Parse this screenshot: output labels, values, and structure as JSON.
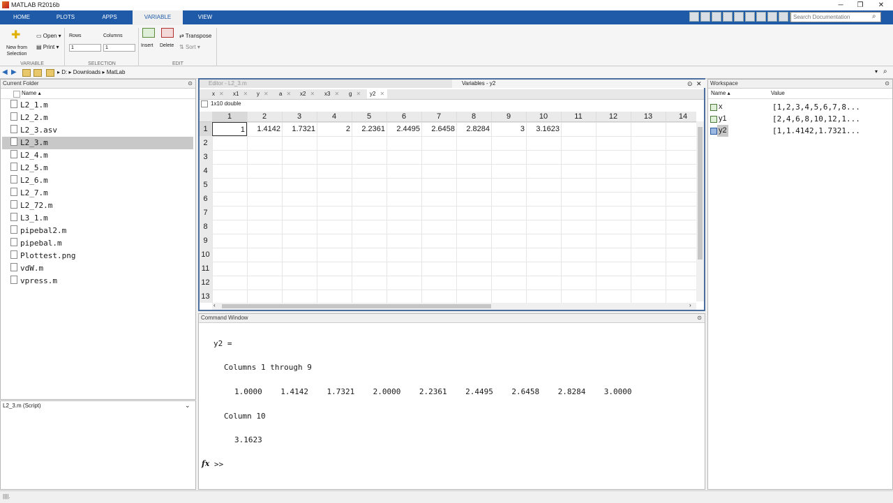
{
  "window": {
    "title": "MATLAB R2016b",
    "controls": [
      "─",
      "❐",
      "✕"
    ]
  },
  "ribbon_tabs": [
    "HOME",
    "PLOTS",
    "APPS",
    "VARIABLE",
    "VIEW"
  ],
  "search": {
    "placeholder": "Search Documentation"
  },
  "ribbon": {
    "new_from_selection": "New from Selection",
    "open": "Open",
    "print": "Print",
    "rows_label": "Rows",
    "columns_label": "Columns",
    "rows_value": "1",
    "columns_value": "1",
    "insert": "Insert",
    "delete": "Delete",
    "transpose": "Transpose",
    "sort": "Sort",
    "groups": [
      "VARIABLE",
      "SELECTION",
      "EDIT"
    ]
  },
  "address": {
    "path": [
      "D:",
      "Downloads",
      "MatLab"
    ]
  },
  "current_folder": {
    "title": "Current Folder",
    "col_name": "Name",
    "files": [
      "L2_1.m",
      "L2_2.m",
      "L2_3.asv",
      "L2_3.m",
      "L2_4.m",
      "L2_5.m",
      "L2_6.m",
      "L2_7.m",
      "L2_72.m",
      "L3_1.m",
      "pipebal2.m",
      "pipebal.m",
      "Plottest.png",
      "vdW.m",
      "vpress.m"
    ],
    "selected_index": 3,
    "details": "L2_3.m (Script)"
  },
  "editor": {
    "title": "Editor - L2_3.m"
  },
  "variables": {
    "title": "Variables - y2",
    "tabs": [
      "x",
      "x1",
      "y",
      "a",
      "x2",
      "x3",
      "g",
      "y2"
    ],
    "active_tab": "y2",
    "size_label": "1x10 double",
    "col_headers": [
      "1",
      "2",
      "3",
      "4",
      "5",
      "6",
      "7",
      "8",
      "9",
      "10",
      "11",
      "12",
      "13",
      "14"
    ],
    "row_headers": [
      "1",
      "2",
      "3",
      "4",
      "5",
      "6",
      "7",
      "8",
      "9",
      "10",
      "11",
      "12",
      "13"
    ],
    "row1": [
      "1",
      "1.4142",
      "1.7321",
      "2",
      "2.2361",
      "2.4495",
      "2.6458",
      "2.8284",
      "3",
      "3.1623"
    ]
  },
  "command_window": {
    "title": "Command Window",
    "lines": [
      "y2 =",
      "Columns 1 through 9",
      "1.0000    1.4142    1.7321    2.0000    2.2361    2.4495    2.6458    2.8284    3.0000",
      "Column 10",
      "3.1623"
    ],
    "prompt": ">>",
    "fx": "fx"
  },
  "workspace": {
    "title": "Workspace",
    "col_name": "Name",
    "col_value": "Value",
    "vars": [
      {
        "name": "x",
        "value": "[1,2,3,4,5,6,7,8..."
      },
      {
        "name": "y1",
        "value": "[2,4,6,8,10,12,1..."
      },
      {
        "name": "y2",
        "value": "[1,1.4142,1.7321..."
      }
    ]
  }
}
